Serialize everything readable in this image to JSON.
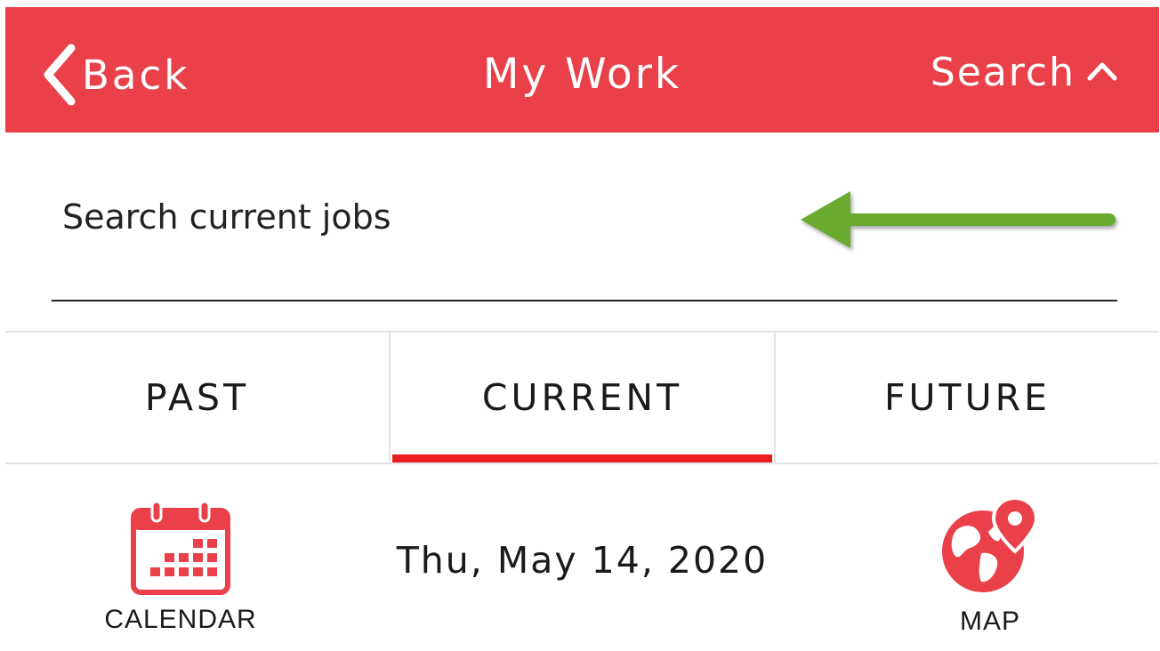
{
  "header": {
    "back_label": "Back",
    "title": "My Work",
    "search_label": "Search"
  },
  "search": {
    "placeholder": "Search current jobs",
    "value": ""
  },
  "tabs": [
    {
      "label": "PAST",
      "selected": false
    },
    {
      "label": "CURRENT",
      "selected": true
    },
    {
      "label": "FUTURE",
      "selected": false
    }
  ],
  "toolbar": {
    "calendar_label": "CALENDAR",
    "date": "Thu, May 14, 2020",
    "map_label": "MAP"
  },
  "icons": {
    "back": "chevron-left-icon",
    "search_toggle": "chevron-up-icon",
    "annotation": "arrow-left-icon",
    "calendar": "calendar-icon",
    "map": "globe-pin-icon"
  },
  "colors": {
    "header_bg": "#e9404a",
    "accent": "#ec1c24",
    "annotation_arrow": "#6aaa2e",
    "text": "#1a1a1a"
  }
}
